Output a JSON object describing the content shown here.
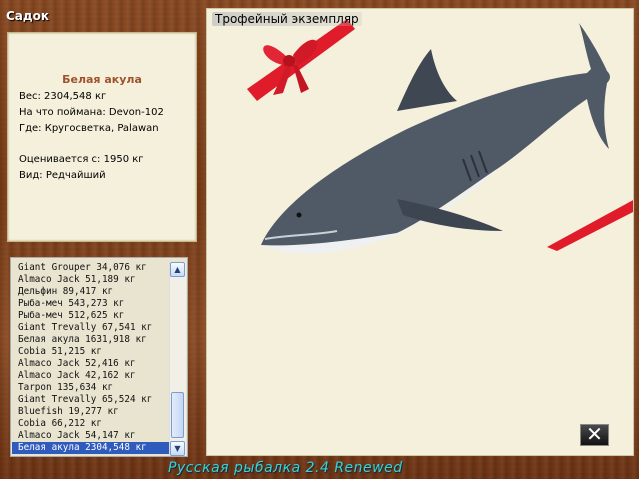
{
  "window": {
    "title": "Садок"
  },
  "info": {
    "fish_name": "Белая акула",
    "weight": "Вес: 2304,548 кг",
    "caught_on": "На что поймана: Devon-102",
    "location": "Где: Кругосветка, Palawan",
    "rated_from": "Оценивается с: 1950 кг",
    "kind": "Вид: Редчайший"
  },
  "catch_list": {
    "items": [
      "Giant Grouper 34,076 кг",
      "Almaco Jack 51,189 кг",
      "Дельфин 89,417 кг",
      "Рыба-меч 543,273 кг",
      "Рыба-меч 512,625 кг",
      "Giant Trevally 67,541 кг",
      "Белая акула 1631,918 кг",
      "Cobia 51,215 кг",
      "Almaco Jack 52,416 кг",
      "Almaco Jack 42,162 кг",
      "Tarpon 135,634 кг",
      "Giant Trevally 65,524 кг",
      "Bluefish 19,277 кг",
      "Cobia 66,212 кг",
      "Almaco Jack 54,147 кг",
      "Белая акула 2304,548 кг"
    ],
    "selected_index": 15
  },
  "trophy": {
    "label": "Трофейный экземпляр",
    "image_icon": "great-white-shark"
  },
  "controls": {
    "close_icon": "close-icon"
  },
  "footer": {
    "text": "Русская рыбалка 2.4 Renewed"
  },
  "colors": {
    "accent_list_selection": "#2f5bbd",
    "footer_text": "#35d3d6",
    "fish_name": "#a0522d"
  }
}
